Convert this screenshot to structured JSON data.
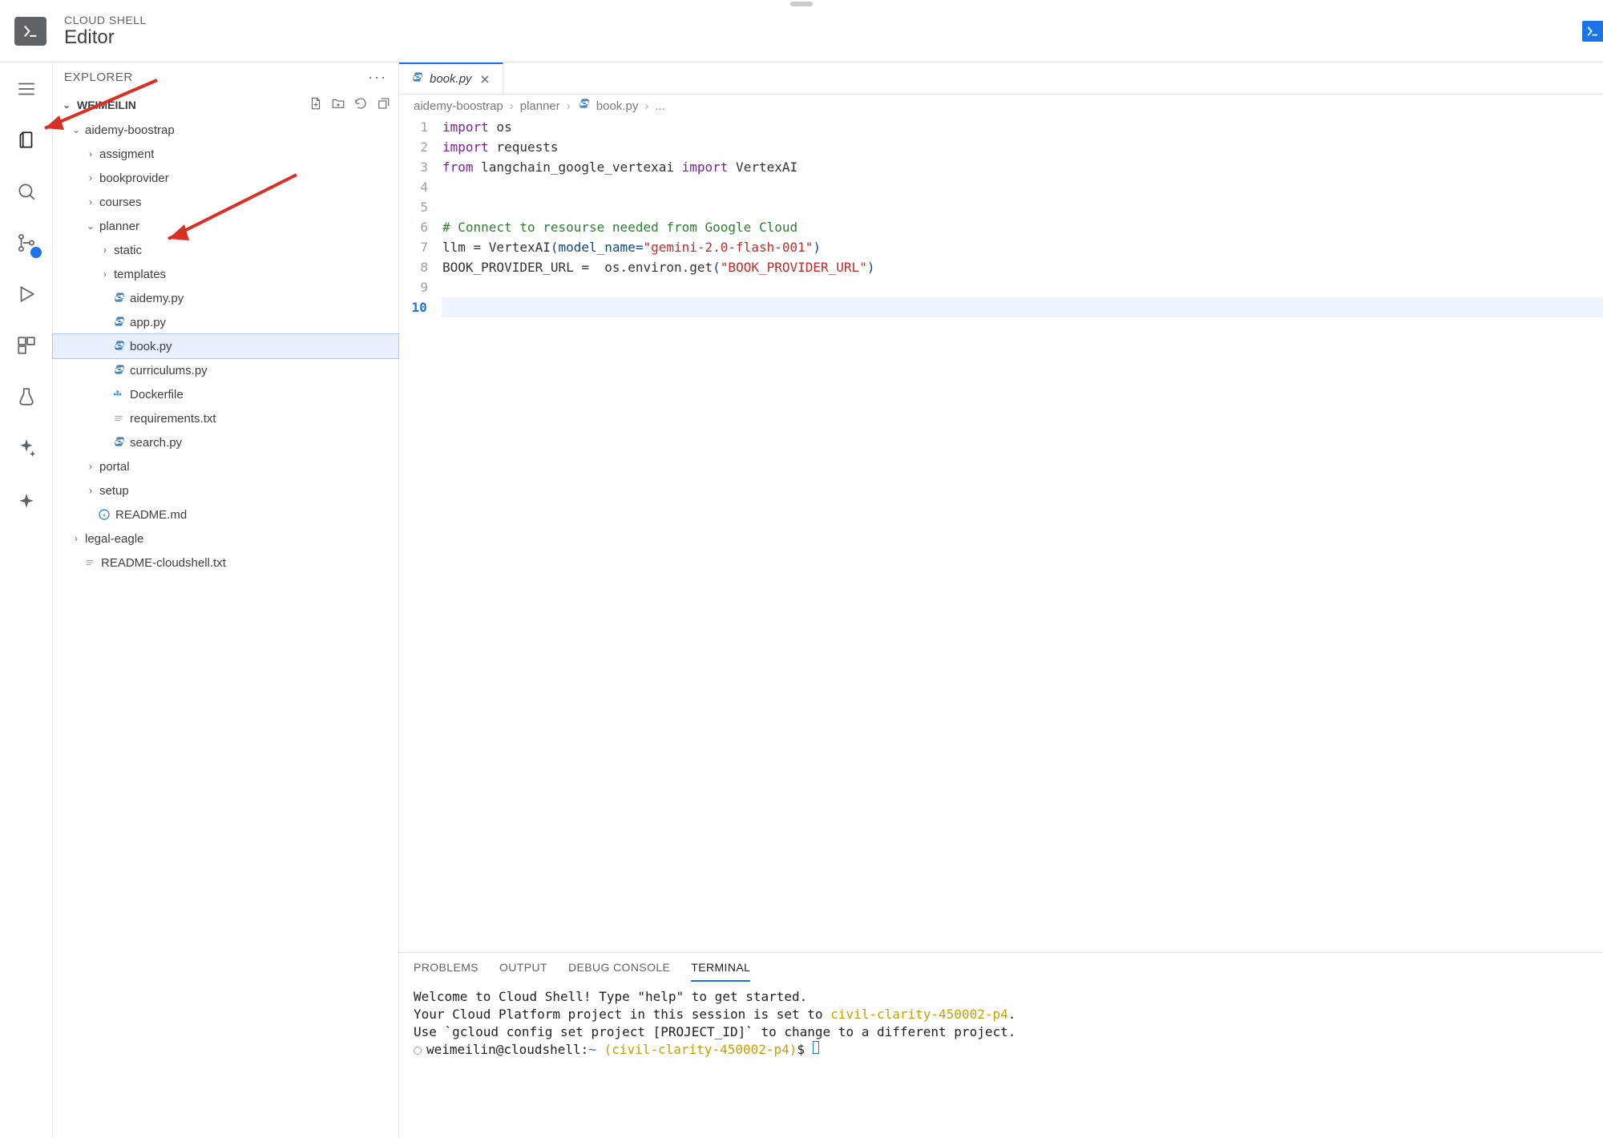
{
  "header": {
    "small": "CLOUD SHELL",
    "big": "Editor"
  },
  "explorer": {
    "title": "EXPLORER",
    "section": "WEIMEILIN",
    "tree": {
      "root": "aidemy-boostrap",
      "root_children": [
        "assigment",
        "bookprovider",
        "courses"
      ],
      "planner": "planner",
      "planner_folders": [
        "static",
        "templates"
      ],
      "planner_files": {
        "aidemy": "aidemy.py",
        "app": "app.py",
        "book": "book.py",
        "curriculums": "curriculums.py",
        "dockerfile": "Dockerfile",
        "requirements": "requirements.txt",
        "search": "search.py"
      },
      "after_planner": [
        "portal",
        "setup"
      ],
      "readme": "README.md",
      "legal": "legal-eagle",
      "readme_cs": "README-cloudshell.txt"
    }
  },
  "tab": {
    "file": "book.py"
  },
  "breadcrumbs": [
    "aidemy-boostrap",
    "planner",
    "book.py",
    "..."
  ],
  "code": {
    "1": {
      "a": "import",
      "b": " os"
    },
    "2": {
      "a": "import",
      "b": " requests"
    },
    "3": {
      "a": "from",
      "b": " langchain_google_vertexai ",
      "c": "import",
      "d": " VertexAI"
    },
    "6": "# Connect to resourse needed from Google Cloud",
    "7": {
      "a": "llm = VertexAI",
      "b": "(model_name=",
      "c": "\"gemini-2.0-flash-001\"",
      "d": ")"
    },
    "8": {
      "a": "BOOK_PROVIDER_URL =  os.environ.get",
      "b": "(",
      "c": "\"BOOK_PROVIDER_URL\"",
      "d": ")"
    }
  },
  "panel": {
    "tabs": [
      "PROBLEMS",
      "OUTPUT",
      "DEBUG CONSOLE",
      "TERMINAL"
    ],
    "lines": {
      "l1": "Welcome to Cloud Shell! Type \"help\" to get started.",
      "l2a": "Your Cloud Platform project in this session is set to ",
      "l2b": "civil-clarity-450002-p4",
      "l2c": ".",
      "l3": "Use `gcloud config set project [PROJECT_ID]` to change to a different project.",
      "prompt_a": "weimeilin@cloudshell:",
      "prompt_b": "~",
      "prompt_c": " (civil-clarity-450002-p4)",
      "prompt_d": "$ "
    }
  }
}
